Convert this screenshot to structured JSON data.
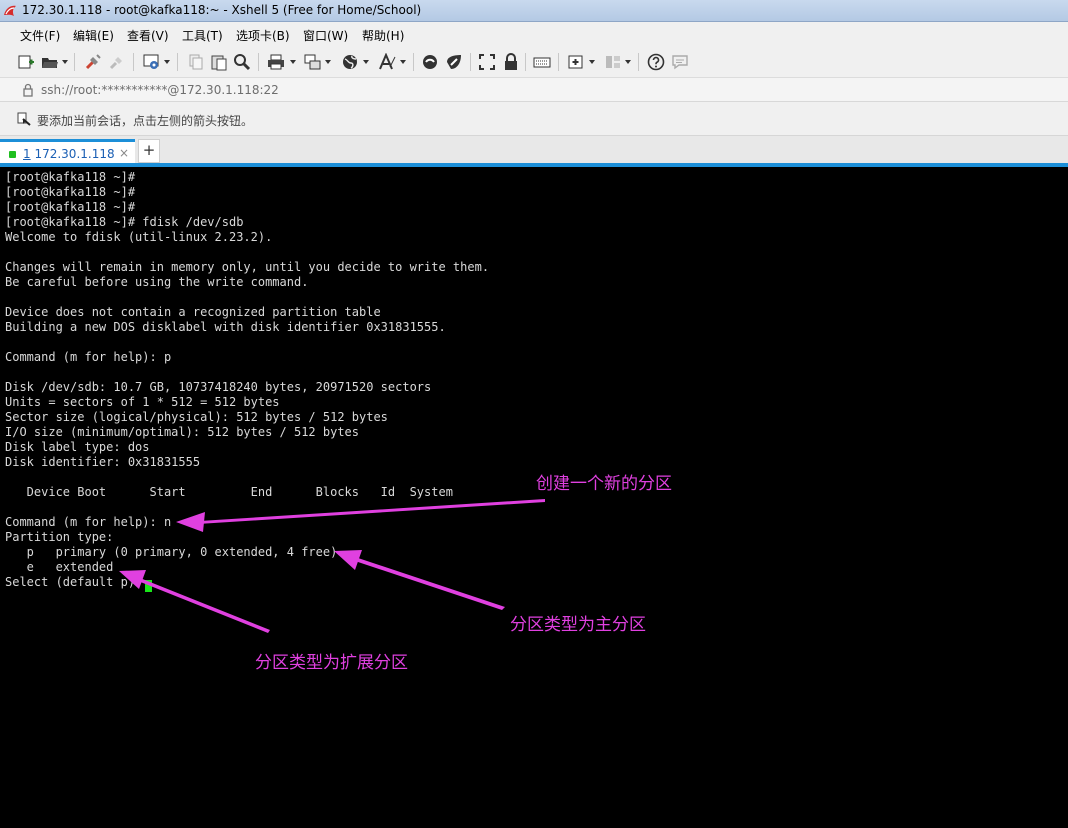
{
  "window": {
    "title": "172.30.1.118 - root@kafka118:~ - Xshell 5 (Free for Home/School)"
  },
  "menu": [
    "文件(F)",
    "编辑(E)",
    "查看(V)",
    "工具(T)",
    "选项卡(B)",
    "窗口(W)",
    "帮助(H)"
  ],
  "address": {
    "text": "ssh://root:***********@172.30.1.118:22"
  },
  "hint": {
    "text": "要添加当前会话，点击左侧的箭头按钮。"
  },
  "tabs": {
    "active": {
      "index": "1",
      "label": " 172.30.1.118",
      "close": "×"
    },
    "add": "+"
  },
  "terminal": {
    "lines": [
      "[root@kafka118 ~]#",
      "[root@kafka118 ~]#",
      "[root@kafka118 ~]#",
      "[root@kafka118 ~]# fdisk /dev/sdb",
      "Welcome to fdisk (util-linux 2.23.2).",
      "",
      "Changes will remain in memory only, until you decide to write them.",
      "Be careful before using the write command.",
      "",
      "Device does not contain a recognized partition table",
      "Building a new DOS disklabel with disk identifier 0x31831555.",
      "",
      "Command (m for help): p",
      "",
      "Disk /dev/sdb: 10.7 GB, 10737418240 bytes, 20971520 sectors",
      "Units = sectors of 1 * 512 = 512 bytes",
      "Sector size (logical/physical): 512 bytes / 512 bytes",
      "I/O size (minimum/optimal): 512 bytes / 512 bytes",
      "Disk label type: dos",
      "Disk identifier: 0x31831555",
      "",
      "   Device Boot      Start         End      Blocks   Id  System",
      "",
      "Command (m for help): n",
      "Partition type:",
      "   p   primary (0 primary, 0 extended, 4 free)",
      "   e   extended",
      "Select (default p): "
    ]
  },
  "annotations": {
    "new_partition": "创建一个新的分区",
    "primary": "分区类型为主分区",
    "extended": "分区类型为扩展分区",
    "color": "#e040e0"
  },
  "colors": {
    "terminal_bg": "#000000",
    "terminal_fg": "#d9d9d9",
    "cursor": "#19e619",
    "tab_accent": "#1c8fd8"
  }
}
